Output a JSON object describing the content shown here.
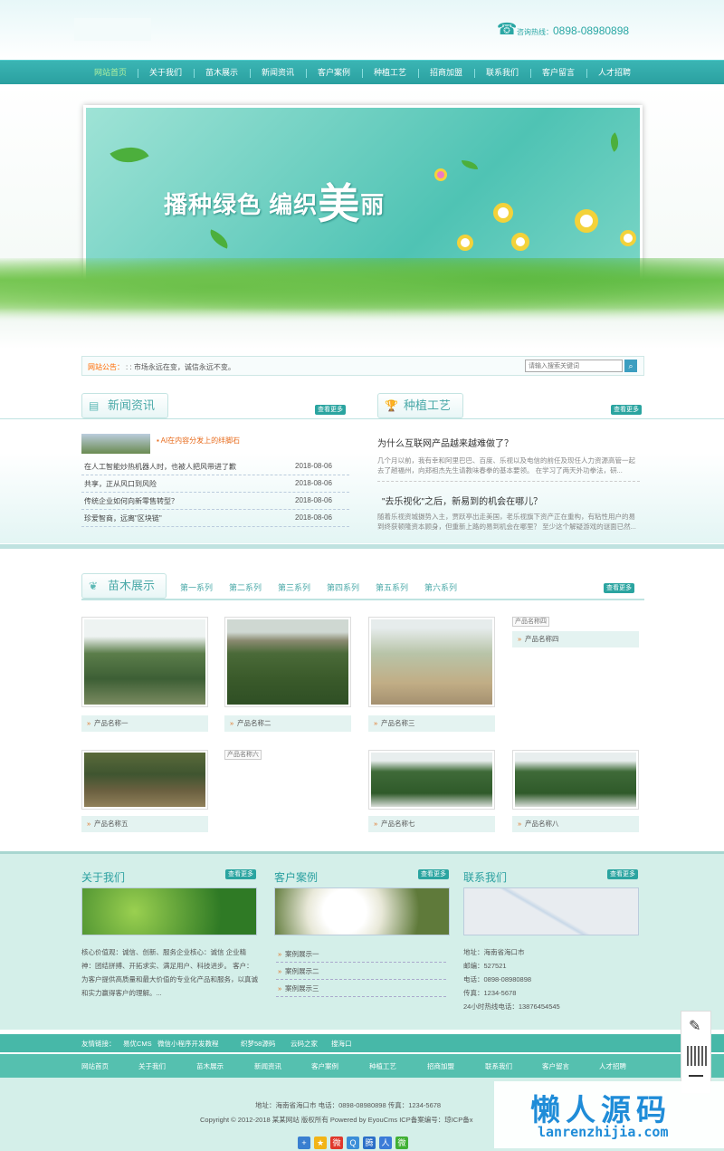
{
  "header": {
    "hotline_label": "咨询热线：",
    "hotline_number": "0898-08980898"
  },
  "nav": [
    "网站首页",
    "关于我们",
    "苗木展示",
    "新闻资讯",
    "客户案例",
    "种植工艺",
    "招商加盟",
    "联系我们",
    "客户留言",
    "人才招聘"
  ],
  "banner": {
    "slogan_part1": "播种绿色  编织",
    "slogan_big": "美",
    "slogan_end": "丽"
  },
  "notice": {
    "label": "网站公告：",
    "text": ": : 市场永远在变，诚信永远不变。",
    "search_placeholder": "请输入搜索关键词"
  },
  "news": {
    "title": "新闻资讯",
    "more": "查看更多",
    "headline": "AI在内容分发上的绊脚石",
    "items": [
      {
        "title": "在人工智能炒热机器人时，也被人把风带进了歉",
        "date": "2018-08-06"
      },
      {
        "title": "共享，正从风口到风险",
        "date": "2018-08-06"
      },
      {
        "title": "传统企业如何向新零售转型？",
        "date": "2018-08-06"
      },
      {
        "title": "珍爱智商，远离\"区块链\"",
        "date": "2018-08-06"
      }
    ]
  },
  "planting": {
    "title": "种植工艺",
    "more": "查看更多",
    "q1": "为什么互联网产品越来越难做了？",
    "d1": "几个月以前，我有幸和阿里巴巴、百度、乐视以及电信的前任及现任人力资源高管一起去了趟福州，向郑祖杰先生请教味春拳的基本要领。 在学习了两天外功拳法，研...",
    "q2": "\"去乐视化\"之后，新易到的机会在哪儿？",
    "d2": "随着乐视资城摄势入主，贾跃亭出走美国，老乐视旗下资产正在重构，有粘性用户的易到终获顿隆资本顾身，但重新上路的易到机会在哪里？ 至少这个解疑游戏的谜面已然..."
  },
  "products": {
    "title": "苗木展示",
    "more": "查看更多",
    "series": [
      "第一系列",
      "第二系列",
      "第三系列",
      "第四系列",
      "第五系列",
      "第六系列"
    ],
    "items": [
      {
        "name": "产品名称一"
      },
      {
        "name": "产品名称二"
      },
      {
        "name": "产品名称三"
      },
      {
        "name": "产品名称四",
        "alt": "产品名称四"
      },
      {
        "name": "产品名称五"
      },
      {
        "name": "产品名称六",
        "alt": "产品名称六"
      },
      {
        "name": "产品名称七"
      },
      {
        "name": "产品名称八"
      }
    ]
  },
  "about": {
    "title": "关于我们",
    "more": "查看更多",
    "text": "核心价值观：诚信、创新、服务企业核心：诚信 企业精神：团结拼搏、开拓求实、满足用户、科技进步。 客户：为客户提供高质量和最大价值的专业化产品和服务，以真诚和实力赢得客户的理解。..."
  },
  "cases": {
    "title": "客户案例",
    "more": "查看更多",
    "items": [
      "案例展示一",
      "案例展示二",
      "案例展示三"
    ]
  },
  "contact": {
    "title": "联系我们",
    "more": "查看更多",
    "lines": [
      "地址：海南省海口市",
      "邮编：527521",
      "电话：0898-08980898",
      "传真：1234-5678",
      "24小时热线电话：13876454545"
    ]
  },
  "links": {
    "label": "友情链接：",
    "items": [
      "易优CMS",
      "微信小程序开发教程",
      "织梦58源码",
      "云码之家",
      "搜海口"
    ]
  },
  "footer": {
    "nav": [
      "网站首页",
      "关于我们",
      "苗木展示",
      "新闻资讯",
      "客户案例",
      "种植工艺",
      "招商加盟",
      "联系我们",
      "客户留言",
      "人才招聘"
    ],
    "address": "地址：海南省海口市   电话：0898-08980898   传真：1234-5678",
    "copyright": "Copyright © 2012-2018 某某网站 版权所有 Powered by EyouCms    ICP备案编号：琼ICP备x"
  },
  "watermark": {
    "cn": "懒人源码",
    "en": "lanrenzhijia.com"
  }
}
